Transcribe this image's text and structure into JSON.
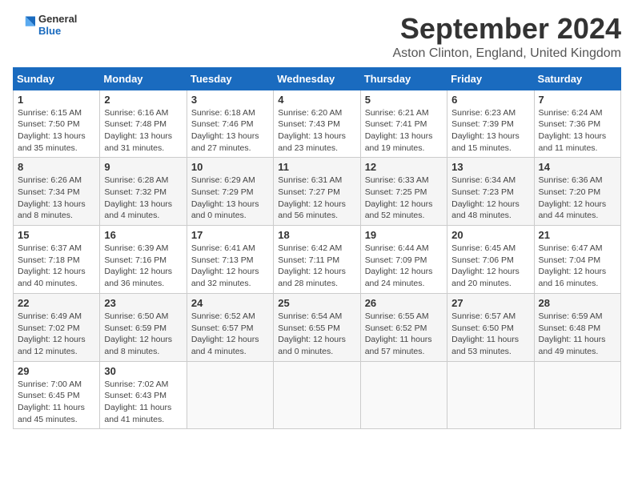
{
  "header": {
    "logo_general": "General",
    "logo_blue": "Blue",
    "month_title": "September 2024",
    "location": "Aston Clinton, England, United Kingdom"
  },
  "weekdays": [
    "Sunday",
    "Monday",
    "Tuesday",
    "Wednesday",
    "Thursday",
    "Friday",
    "Saturday"
  ],
  "weeks": [
    [
      {
        "day": "1",
        "info": "Sunrise: 6:15 AM\nSunset: 7:50 PM\nDaylight: 13 hours\nand 35 minutes."
      },
      {
        "day": "2",
        "info": "Sunrise: 6:16 AM\nSunset: 7:48 PM\nDaylight: 13 hours\nand 31 minutes."
      },
      {
        "day": "3",
        "info": "Sunrise: 6:18 AM\nSunset: 7:46 PM\nDaylight: 13 hours\nand 27 minutes."
      },
      {
        "day": "4",
        "info": "Sunrise: 6:20 AM\nSunset: 7:43 PM\nDaylight: 13 hours\nand 23 minutes."
      },
      {
        "day": "5",
        "info": "Sunrise: 6:21 AM\nSunset: 7:41 PM\nDaylight: 13 hours\nand 19 minutes."
      },
      {
        "day": "6",
        "info": "Sunrise: 6:23 AM\nSunset: 7:39 PM\nDaylight: 13 hours\nand 15 minutes."
      },
      {
        "day": "7",
        "info": "Sunrise: 6:24 AM\nSunset: 7:36 PM\nDaylight: 13 hours\nand 11 minutes."
      }
    ],
    [
      {
        "day": "8",
        "info": "Sunrise: 6:26 AM\nSunset: 7:34 PM\nDaylight: 13 hours\nand 8 minutes."
      },
      {
        "day": "9",
        "info": "Sunrise: 6:28 AM\nSunset: 7:32 PM\nDaylight: 13 hours\nand 4 minutes."
      },
      {
        "day": "10",
        "info": "Sunrise: 6:29 AM\nSunset: 7:29 PM\nDaylight: 13 hours\nand 0 minutes."
      },
      {
        "day": "11",
        "info": "Sunrise: 6:31 AM\nSunset: 7:27 PM\nDaylight: 12 hours\nand 56 minutes."
      },
      {
        "day": "12",
        "info": "Sunrise: 6:33 AM\nSunset: 7:25 PM\nDaylight: 12 hours\nand 52 minutes."
      },
      {
        "day": "13",
        "info": "Sunrise: 6:34 AM\nSunset: 7:23 PM\nDaylight: 12 hours\nand 48 minutes."
      },
      {
        "day": "14",
        "info": "Sunrise: 6:36 AM\nSunset: 7:20 PM\nDaylight: 12 hours\nand 44 minutes."
      }
    ],
    [
      {
        "day": "15",
        "info": "Sunrise: 6:37 AM\nSunset: 7:18 PM\nDaylight: 12 hours\nand 40 minutes."
      },
      {
        "day": "16",
        "info": "Sunrise: 6:39 AM\nSunset: 7:16 PM\nDaylight: 12 hours\nand 36 minutes."
      },
      {
        "day": "17",
        "info": "Sunrise: 6:41 AM\nSunset: 7:13 PM\nDaylight: 12 hours\nand 32 minutes."
      },
      {
        "day": "18",
        "info": "Sunrise: 6:42 AM\nSunset: 7:11 PM\nDaylight: 12 hours\nand 28 minutes."
      },
      {
        "day": "19",
        "info": "Sunrise: 6:44 AM\nSunset: 7:09 PM\nDaylight: 12 hours\nand 24 minutes."
      },
      {
        "day": "20",
        "info": "Sunrise: 6:45 AM\nSunset: 7:06 PM\nDaylight: 12 hours\nand 20 minutes."
      },
      {
        "day": "21",
        "info": "Sunrise: 6:47 AM\nSunset: 7:04 PM\nDaylight: 12 hours\nand 16 minutes."
      }
    ],
    [
      {
        "day": "22",
        "info": "Sunrise: 6:49 AM\nSunset: 7:02 PM\nDaylight: 12 hours\nand 12 minutes."
      },
      {
        "day": "23",
        "info": "Sunrise: 6:50 AM\nSunset: 6:59 PM\nDaylight: 12 hours\nand 8 minutes."
      },
      {
        "day": "24",
        "info": "Sunrise: 6:52 AM\nSunset: 6:57 PM\nDaylight: 12 hours\nand 4 minutes."
      },
      {
        "day": "25",
        "info": "Sunrise: 6:54 AM\nSunset: 6:55 PM\nDaylight: 12 hours\nand 0 minutes."
      },
      {
        "day": "26",
        "info": "Sunrise: 6:55 AM\nSunset: 6:52 PM\nDaylight: 11 hours\nand 57 minutes."
      },
      {
        "day": "27",
        "info": "Sunrise: 6:57 AM\nSunset: 6:50 PM\nDaylight: 11 hours\nand 53 minutes."
      },
      {
        "day": "28",
        "info": "Sunrise: 6:59 AM\nSunset: 6:48 PM\nDaylight: 11 hours\nand 49 minutes."
      }
    ],
    [
      {
        "day": "29",
        "info": "Sunrise: 7:00 AM\nSunset: 6:45 PM\nDaylight: 11 hours\nand 45 minutes."
      },
      {
        "day": "30",
        "info": "Sunrise: 7:02 AM\nSunset: 6:43 PM\nDaylight: 11 hours\nand 41 minutes."
      },
      {
        "day": "",
        "info": ""
      },
      {
        "day": "",
        "info": ""
      },
      {
        "day": "",
        "info": ""
      },
      {
        "day": "",
        "info": ""
      },
      {
        "day": "",
        "info": ""
      }
    ]
  ]
}
